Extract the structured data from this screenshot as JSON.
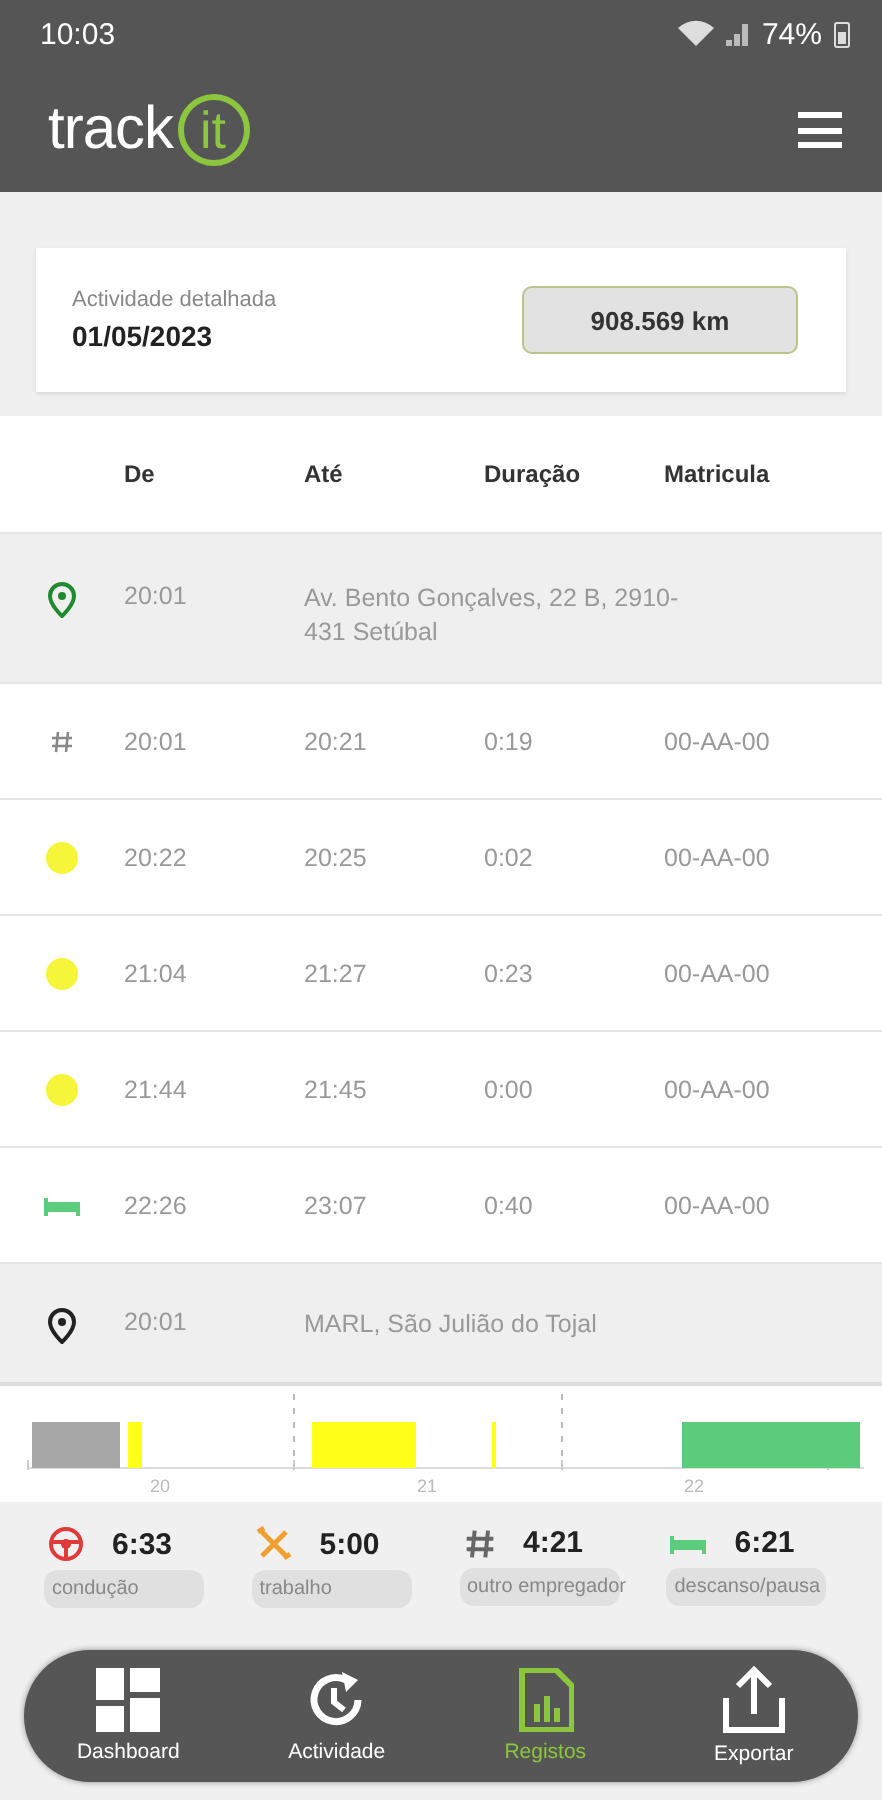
{
  "status_bar": {
    "time": "10:03",
    "battery": "74%"
  },
  "app_bar": {
    "logo_text": "track",
    "logo_mark": "it"
  },
  "summary_card": {
    "label": "Actividade detalhada",
    "date": "01/05/2023",
    "distance": "908.569 km"
  },
  "table": {
    "columns": [
      "De",
      "Até",
      "Duração",
      "Matricula"
    ],
    "rows": [
      {
        "kind": "start",
        "from": "20:01",
        "address": "Av. Bento Gonçalves, 22 B, 2910-431 Setúbal"
      },
      {
        "kind": "other",
        "from": "20:01",
        "to": "20:21",
        "duration": "0:19",
        "plate": "00-AA-00"
      },
      {
        "kind": "work",
        "from": "20:22",
        "to": "20:25",
        "duration": "0:02",
        "plate": "00-AA-00"
      },
      {
        "kind": "work",
        "from": "21:04",
        "to": "21:27",
        "duration": "0:23",
        "plate": "00-AA-00"
      },
      {
        "kind": "work",
        "from": "21:44",
        "to": "21:45",
        "duration": "0:00",
        "plate": "00-AA-00"
      },
      {
        "kind": "rest",
        "from": "22:26",
        "to": "23:07",
        "duration": "0:40",
        "plate": "00-AA-00"
      },
      {
        "kind": "end",
        "from": "20:01",
        "address": "MARL, São Julião do Tojal"
      }
    ]
  },
  "timeline": {
    "tick_labels": [
      "20",
      "21",
      "22"
    ]
  },
  "totals": [
    {
      "kind": "driving",
      "value": "6:33",
      "label": "condução"
    },
    {
      "kind": "work",
      "value": "5:00",
      "label": "trabalho"
    },
    {
      "kind": "other",
      "value": "4:21",
      "label": "outro empregador"
    },
    {
      "kind": "rest",
      "value": "6:21",
      "label": "descanso/pausa"
    }
  ],
  "nav": [
    {
      "kind": "dashboard",
      "label": "Dashboard",
      "selected": false
    },
    {
      "kind": "activity",
      "label": "Actividade",
      "selected": false
    },
    {
      "kind": "records",
      "label": "Registos",
      "selected": true
    },
    {
      "kind": "export",
      "label": "Exportar",
      "selected": false
    }
  ]
}
